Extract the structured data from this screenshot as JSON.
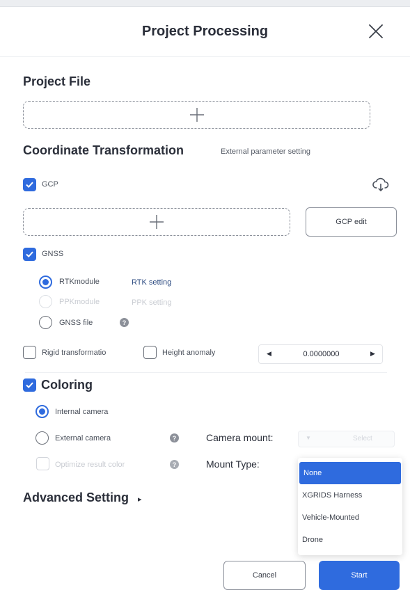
{
  "title": "Project Processing",
  "accent_color": "#2f6bde",
  "project_file": {
    "heading": "Project File"
  },
  "coordinate": {
    "heading": "Coordinate Transformation",
    "subtitle": "External parameter setting",
    "gcp": {
      "label": "GCP",
      "checked": true,
      "edit_button": "GCP edit",
      "icon": "cloud-download-icon"
    },
    "gnss": {
      "label": "GNSS",
      "checked": true,
      "options": [
        {
          "label": "RTKmodule",
          "selected": true,
          "disabled": false,
          "setting_label": "RTK setting"
        },
        {
          "label": "PPKmodule",
          "selected": false,
          "disabled": true,
          "setting_label": "PPK setting"
        },
        {
          "label": "GNSS file",
          "selected": false,
          "disabled": false
        }
      ]
    },
    "rigid": {
      "label": "Rigid transformatio",
      "checked": false
    },
    "height_anomaly": {
      "label": "Height anomaly",
      "checked": false
    },
    "height_value": "0.0000000"
  },
  "coloring": {
    "heading": "Coloring",
    "checked": true,
    "internal_camera": "Internal camera",
    "external_camera": "External camera",
    "optimize_label": "Optimize result color",
    "camera_mount_label": "Camera mount:",
    "camera_mount_value": "Select",
    "mount_type_label": "Mount Type:",
    "mount_type_options": [
      "None",
      "XGRIDS Harness",
      "Vehicle-Mounted",
      "Drone"
    ],
    "mount_type_selected": "None"
  },
  "advanced": {
    "label": "Advanced Setting",
    "arrow": "▸"
  },
  "footer": {
    "cancel": "Cancel",
    "start": "Start"
  }
}
